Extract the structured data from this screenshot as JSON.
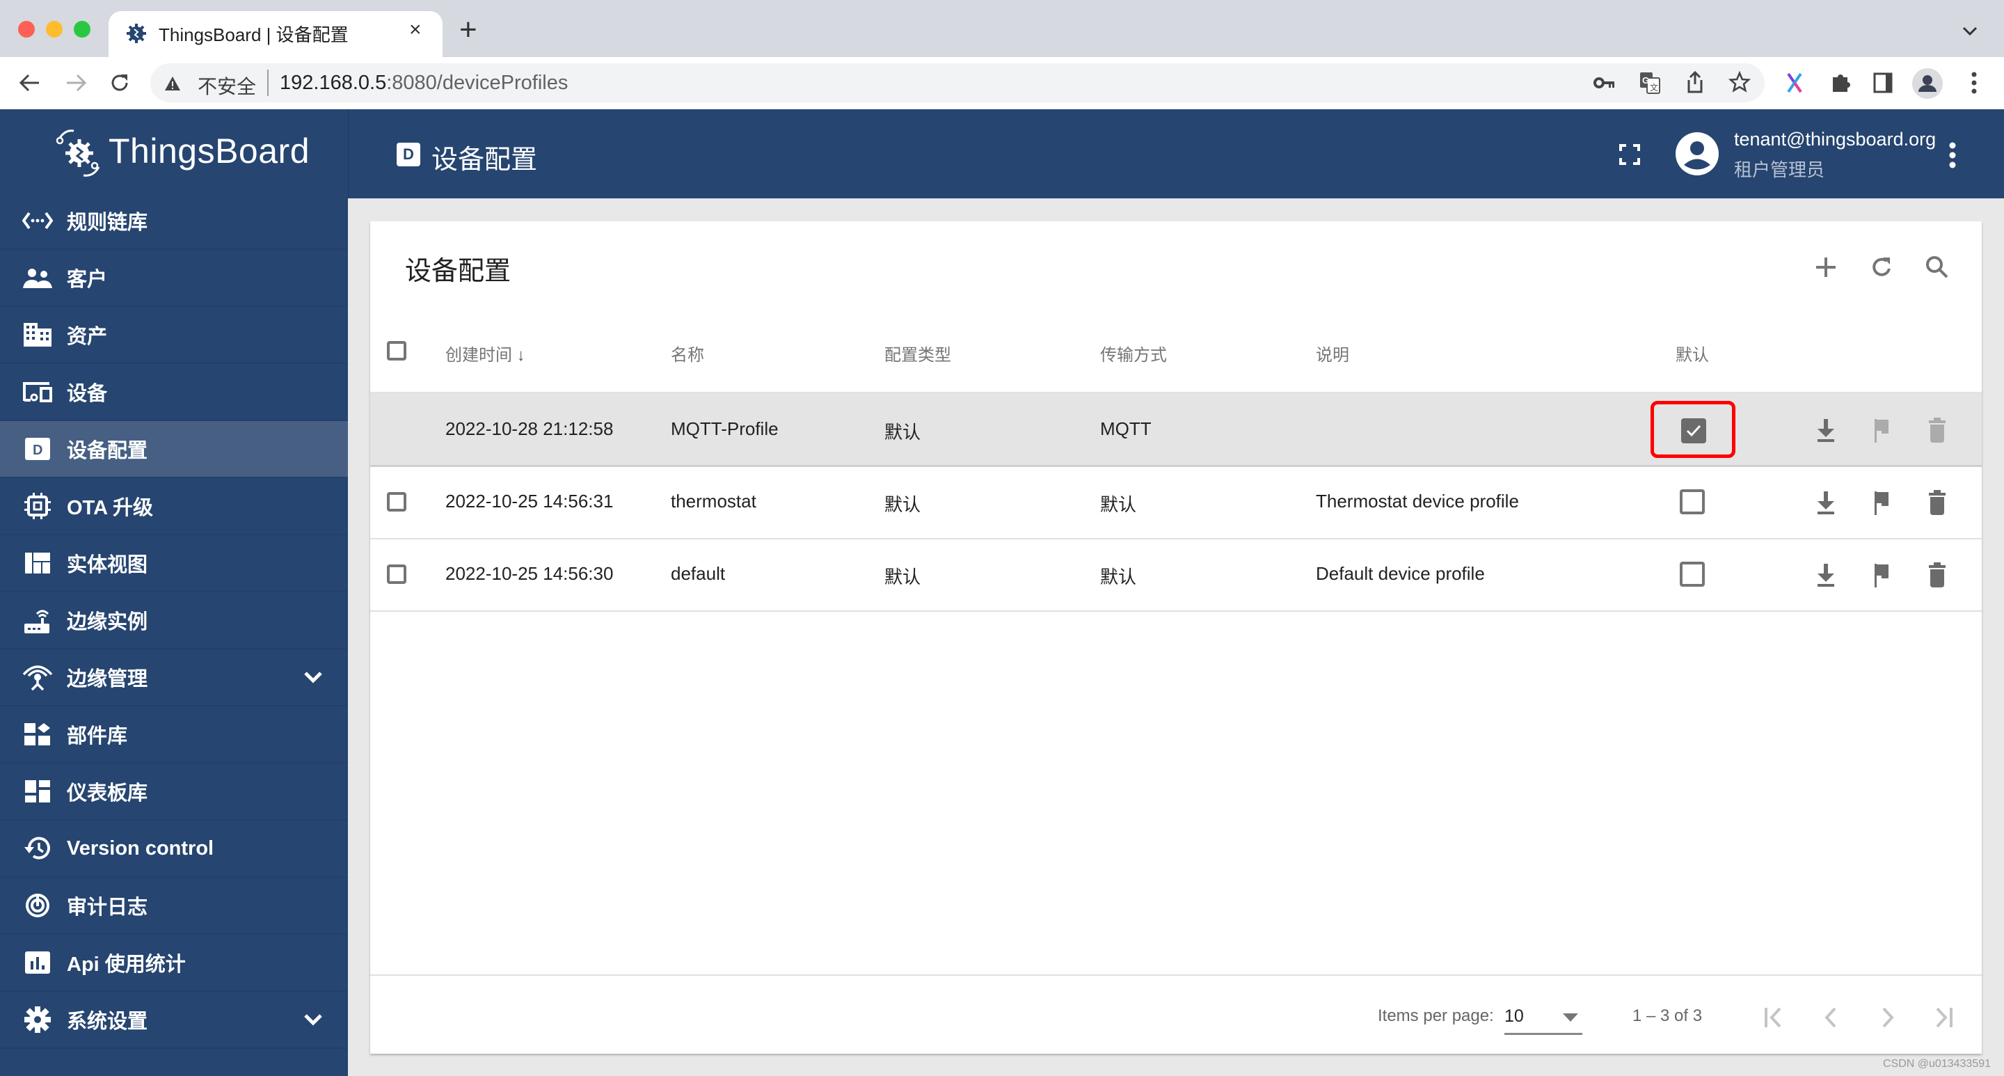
{
  "browser": {
    "tab_title": "ThingsBoard | 设备配置",
    "tab_close": "×",
    "new_tab": "+",
    "tab_list": "⌄",
    "security_label": "不安全",
    "url_host": "192.168.0.5",
    "url_path": ":8080/deviceProfiles",
    "toolbar_icons": [
      "key-icon",
      "translate-icon",
      "share-icon",
      "star-icon",
      "extension-x-icon",
      "puzzle-icon",
      "sidepanel-icon",
      "profile-icon",
      "menu-icon"
    ]
  },
  "header": {
    "logo_text": "ThingsBoard",
    "page_icon_letter": "D",
    "page_title": "设备配置",
    "user_email": "tenant@thingsboard.org",
    "user_role": "租户管理员"
  },
  "sidebar": {
    "items": [
      {
        "label": "规则链库",
        "icon": "rule-chain-icon",
        "active": false
      },
      {
        "label": "客户",
        "icon": "customers-icon",
        "active": false
      },
      {
        "label": "资产",
        "icon": "assets-icon",
        "active": false
      },
      {
        "label": "设备",
        "icon": "devices-icon",
        "active": false
      },
      {
        "label": "设备配置",
        "icon": "device-profile-icon",
        "active": true
      },
      {
        "label": "OTA 升级",
        "icon": "ota-icon",
        "active": false
      },
      {
        "label": "实体视图",
        "icon": "entity-view-icon",
        "active": false
      },
      {
        "label": "边缘实例",
        "icon": "edge-instance-icon",
        "active": false
      },
      {
        "label": "边缘管理",
        "icon": "edge-management-icon",
        "active": false,
        "expandable": true
      },
      {
        "label": "部件库",
        "icon": "widgets-icon",
        "active": false
      },
      {
        "label": "仪表板库",
        "icon": "dashboards-icon",
        "active": false
      },
      {
        "label": "Version control",
        "icon": "version-control-icon",
        "active": false
      },
      {
        "label": "审计日志",
        "icon": "audit-log-icon",
        "active": false
      },
      {
        "label": "Api 使用统计",
        "icon": "api-usage-icon",
        "active": false
      },
      {
        "label": "系统设置",
        "icon": "settings-icon",
        "active": false,
        "expandable": true
      }
    ]
  },
  "card": {
    "title": "设备配置",
    "actions": [
      "add-icon",
      "refresh-icon",
      "search-icon"
    ],
    "columns": [
      "创建时间",
      "名称",
      "配置类型",
      "传输方式",
      "说明",
      "默认"
    ],
    "sort_indicator": "↓",
    "rows": [
      {
        "created": "2022-10-28 21:12:58",
        "name": "MQTT-Profile",
        "type": "默认",
        "transport": "MQTT",
        "description": "",
        "is_default": true,
        "selected": true
      },
      {
        "created": "2022-10-25 14:56:31",
        "name": "thermostat",
        "type": "默认",
        "transport": "默认",
        "description": "Thermostat device profile",
        "is_default": false,
        "selected": false
      },
      {
        "created": "2022-10-25 14:56:30",
        "name": "default",
        "type": "默认",
        "transport": "默认",
        "description": "Default device profile",
        "is_default": false,
        "selected": false
      }
    ]
  },
  "pagination": {
    "items_per_page_label": "Items per page:",
    "items_per_page": "10",
    "range": "1 – 3 of 3"
  },
  "watermark": "CSDN @u013433591",
  "colors": {
    "primary": "#264570",
    "sidebar_active": "#465f83",
    "highlight": "#ff0000",
    "selected_row": "#e4e4e4"
  }
}
